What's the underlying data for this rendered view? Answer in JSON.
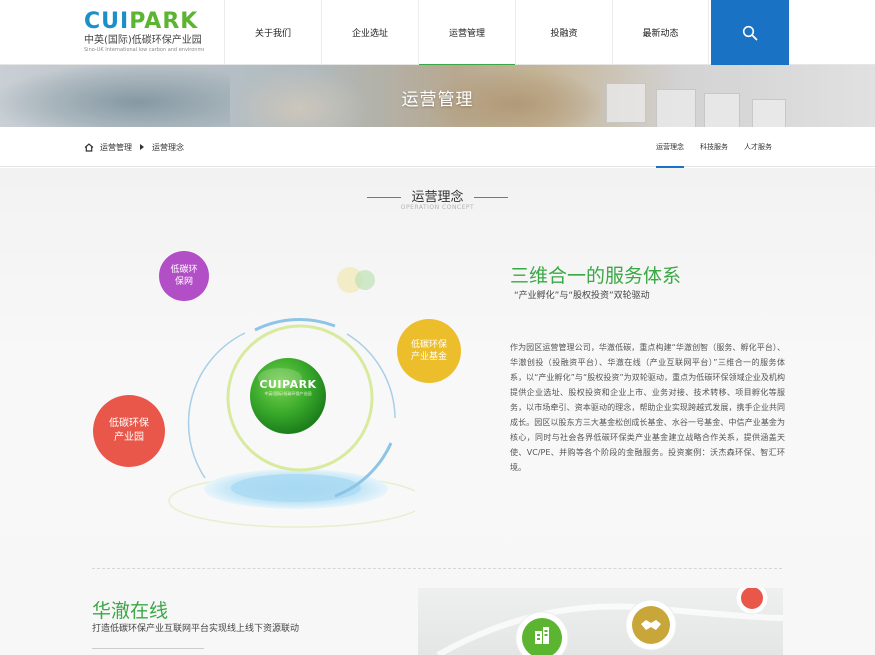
{
  "logo": {
    "brand_part1": "CUI",
    "brand_part2": "PARK",
    "subtitle": "中英(国际)低碳环保产业园",
    "tagline": "Sino-UK International low carbon and environmental protection industrial park"
  },
  "nav": {
    "items": [
      {
        "label": "关于我们"
      },
      {
        "label": "企业选址"
      },
      {
        "label": "运营管理"
      },
      {
        "label": "投融资"
      },
      {
        "label": "最新动态"
      }
    ],
    "active_index": 2,
    "search_icon": "search-icon"
  },
  "banner": {
    "title": "运营管理"
  },
  "breadcrumb": {
    "home_icon": "home-icon",
    "items": [
      "运营管理",
      "运营理念"
    ]
  },
  "subnav": {
    "items": [
      "运营理念",
      "科技服务",
      "人才服务"
    ],
    "active_index": 0
  },
  "section": {
    "title": "运营理念",
    "subtitle": "OPERATION CONCEPT"
  },
  "diagram": {
    "center_logo_part1": "CUI",
    "center_logo_part2": "PARK",
    "center_sub": "中英(国际)低碳环保产业园",
    "bubbles": [
      {
        "label_line1": "低碳环",
        "label_line2": "保网",
        "color": "#b24fc7"
      },
      {
        "label_line1": "低碳环保",
        "label_line2": "产业基金",
        "color": "#ecbe2b"
      },
      {
        "label_line1": "低碳环保",
        "label_line2": "产业园",
        "color": "#e9574a"
      }
    ]
  },
  "intro": {
    "title": "三维合一的服务体系",
    "subtitle": "“产业孵化”与“股权投资”双轮驱动",
    "paragraph": "作为园区运营管理公司，华澈低碳，重点构建“华澈创智（服务、孵化平台）、华澈创投（投融资平台）、华澈在线（产业互联网平台）”三维合一的服务体系，以“产业孵化”与“股权投资”为双轮驱动，重点为低碳环保领域企业及机构提供企业选址、股权投资和企业上市、业务对接、技术转移、项目孵化等服务，以市场牵引、资本驱动的理念，帮助企业实现跨越式发展，携手企业共同成长。园区以股东方三大基金松创成长基金、水谷一号基金、中信产业基金为核心，同时与社会各界低碳环保类产业基金建立战略合作关系，提供涵盖天使、VC/PE、并购等各个阶段的金融服务。投资案例：沃杰森环保、智汇环境。"
  },
  "online": {
    "title": "华澈在线",
    "subtitle": "打造低碳环保产业互联网平台实现线上线下资源联动"
  },
  "colors": {
    "accent_green": "#3aa845",
    "accent_blue": "#1a72c4"
  }
}
